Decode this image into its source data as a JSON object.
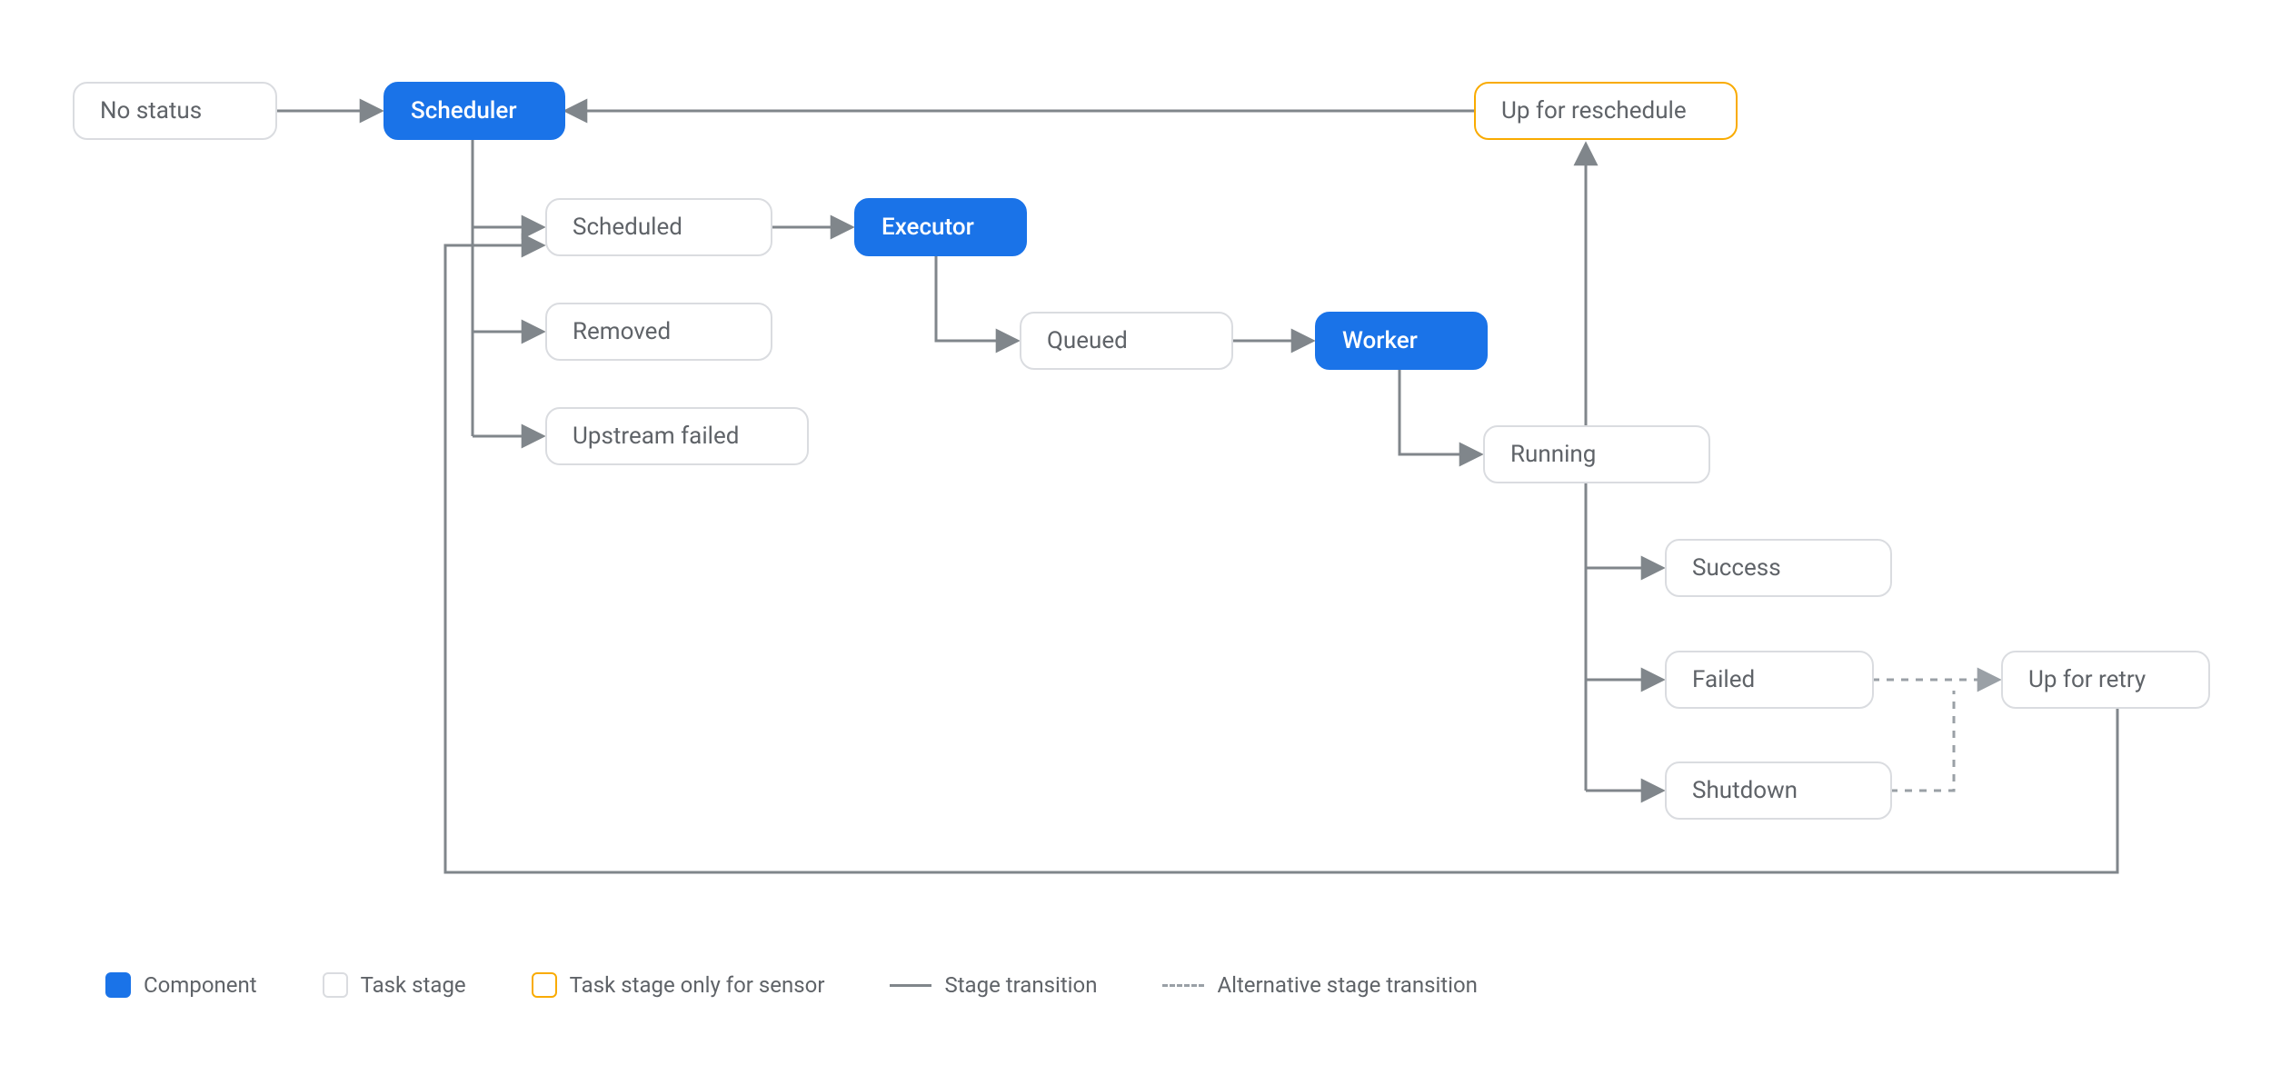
{
  "nodes": {
    "no_status": "No status",
    "scheduler": "Scheduler",
    "scheduled": "Scheduled",
    "removed": "Removed",
    "upstream_failed": "Upstream failed",
    "executor": "Executor",
    "queued": "Queued",
    "worker": "Worker",
    "running": "Running",
    "success": "Success",
    "failed": "Failed",
    "shutdown": "Shutdown",
    "up_for_retry": "Up for retry",
    "up_for_reschedule": "Up for reschedule"
  },
  "legend": {
    "component": "Component",
    "task_stage": "Task stage",
    "sensor_stage": "Task stage only for sensor",
    "transition": "Stage transition",
    "alt_transition": "Alternative stage transition"
  },
  "colors": {
    "component_bg": "#1a73e8",
    "stage_border": "#dadce0",
    "sensor_border": "#f9ab00",
    "text": "#5f6368",
    "edge": "#80868b",
    "edge_alt": "#9aa0a6"
  },
  "edges": [
    {
      "from": "no_status",
      "to": "scheduler",
      "style": "solid"
    },
    {
      "from": "scheduler",
      "to": "scheduled",
      "style": "solid"
    },
    {
      "from": "scheduler",
      "to": "removed",
      "style": "solid"
    },
    {
      "from": "scheduler",
      "to": "upstream_failed",
      "style": "solid"
    },
    {
      "from": "scheduled",
      "to": "executor",
      "style": "solid"
    },
    {
      "from": "executor",
      "to": "queued",
      "style": "solid"
    },
    {
      "from": "queued",
      "to": "worker",
      "style": "solid"
    },
    {
      "from": "worker",
      "to": "running",
      "style": "solid"
    },
    {
      "from": "running",
      "to": "success",
      "style": "solid"
    },
    {
      "from": "running",
      "to": "failed",
      "style": "solid"
    },
    {
      "from": "running",
      "to": "shutdown",
      "style": "solid"
    },
    {
      "from": "running",
      "to": "up_for_reschedule",
      "style": "solid"
    },
    {
      "from": "up_for_reschedule",
      "to": "scheduler",
      "style": "solid"
    },
    {
      "from": "failed",
      "to": "up_for_retry",
      "style": "dashed"
    },
    {
      "from": "shutdown",
      "to": "up_for_retry",
      "style": "dashed"
    },
    {
      "from": "up_for_retry",
      "to": "scheduled",
      "style": "solid"
    }
  ]
}
